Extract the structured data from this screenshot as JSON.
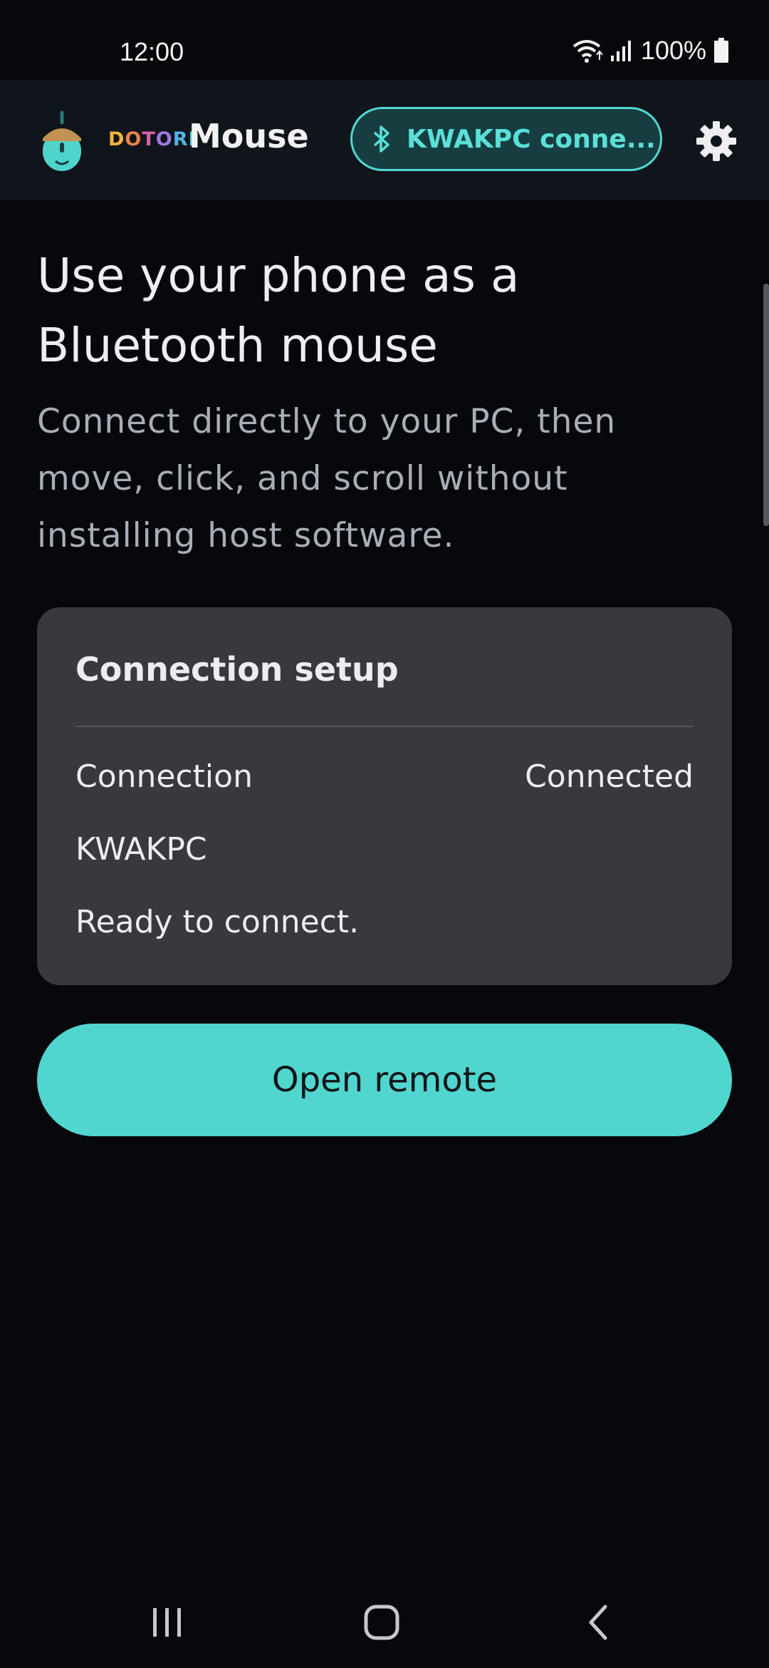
{
  "status_bar": {
    "time": "12:00",
    "battery": "100%"
  },
  "app_bar": {
    "brand_prefix": "DOTORI",
    "brand_name": "Mouse",
    "connection_chip": "KWAKPC conne...",
    "colors": {
      "accent": "#50d6cf",
      "chip_background": "#163e41",
      "bar_background": "#10141b"
    }
  },
  "hero": {
    "title": "Use your phone as a Bluetooth mouse",
    "subtitle": "Connect directly to your PC, then move, click, and scroll without installing host software."
  },
  "card": {
    "title": "Connection setup",
    "connection_label": "Connection",
    "connection_value": "Connected",
    "device_name": "KWAKPC",
    "status_message": "Ready to connect."
  },
  "primary_button": {
    "label": "Open remote"
  },
  "nav_bar": {
    "icons": [
      "recent-apps-icon",
      "home-icon",
      "back-icon"
    ]
  }
}
